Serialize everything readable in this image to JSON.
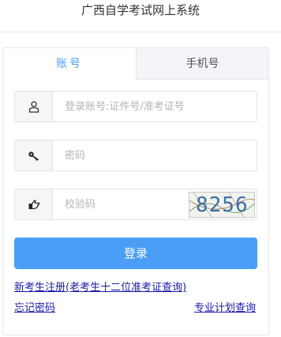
{
  "header": {
    "title": "广西自学考试网上系统"
  },
  "tabs": {
    "account": "账号",
    "phone": "手机号",
    "active": "account"
  },
  "form": {
    "username": {
      "placeholder": "登录账号:证件号/准考证号",
      "icon": "user-icon"
    },
    "password": {
      "placeholder": "密码",
      "icon": "key-icon"
    },
    "verification": {
      "placeholder": "校验码",
      "icon": "pointing-hand-icon",
      "captcha_text": "8256"
    },
    "submit_label": "登录"
  },
  "links": {
    "register": "新考生注册(老考生十二位准考证查询)",
    "forgot_password": "忘记密码",
    "major_plan": "专业计划查询"
  },
  "colors": {
    "accent": "#4a9ef5",
    "link": "#1a1aa8",
    "tab_active_text": "#4a9cf3"
  }
}
